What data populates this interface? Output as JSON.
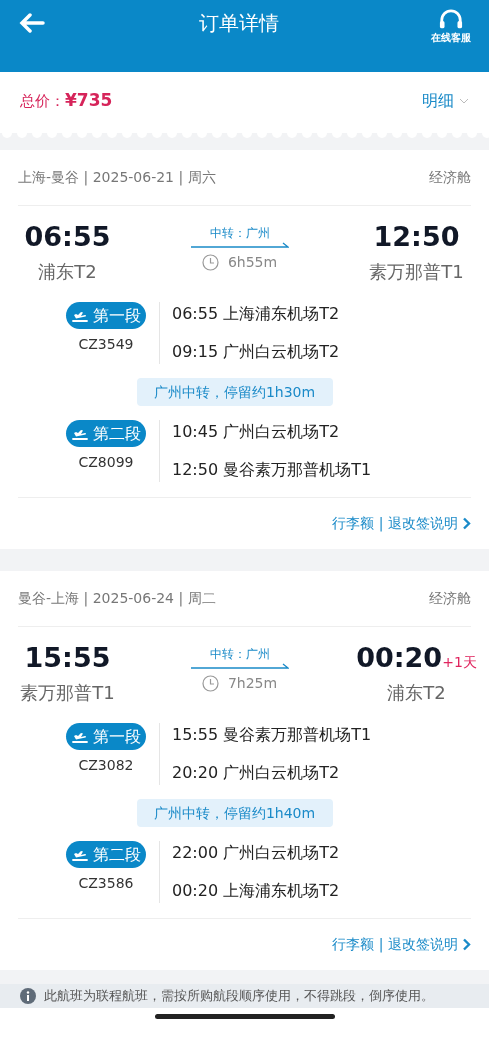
{
  "header": {
    "title": "订单详情",
    "support_label": "在线客服"
  },
  "price": {
    "label": "总价：",
    "amount": "¥735",
    "detail": "明细"
  },
  "trips": [
    {
      "summary": "上海-曼谷 | 2025-06-21 | 周六",
      "cabin": "经济舱",
      "dep_time": "06:55",
      "dep_airport": "浦东T2",
      "transfer": "中转：广州",
      "duration": "6h55m",
      "arr_time": "12:50",
      "arr_airport": "素万那普T1",
      "segments": [
        {
          "badge": "第一段",
          "flight": "CZ3549",
          "dep": "06:55 上海浦东机场T2",
          "arr": "09:15 广州白云机场T2"
        },
        {
          "badge": "第二段",
          "flight": "CZ8099",
          "dep": "10:45 广州白云机场T2",
          "arr": "12:50 曼谷素万那普机场T1"
        }
      ],
      "layover": "广州中转，停留约1h30m",
      "link": "行李额 | 退改签说明"
    },
    {
      "summary": "曼谷-上海 | 2025-06-24 | 周二",
      "cabin": "经济舱",
      "dep_time": "15:55",
      "dep_airport": "素万那普T1",
      "transfer": "中转：广州",
      "duration": "7h25m",
      "arr_time": "00:20",
      "arr_day_offset": "+1天",
      "arr_airport": "浦东T2",
      "segments": [
        {
          "badge": "第一段",
          "flight": "CZ3082",
          "dep": "15:55 曼谷素万那普机场T1",
          "arr": "20:20 广州白云机场T2"
        },
        {
          "badge": "第二段",
          "flight": "CZ3586",
          "dep": "22:00 广州白云机场T2",
          "arr": "00:20 上海浦东机场T2"
        }
      ],
      "layover": "广州中转，停留约1h40m",
      "link": "行李额 | 退改签说明"
    }
  ],
  "notice": "此航班为联程航班，需按所购航段顺序使用，不得跳段，倒序使用。"
}
